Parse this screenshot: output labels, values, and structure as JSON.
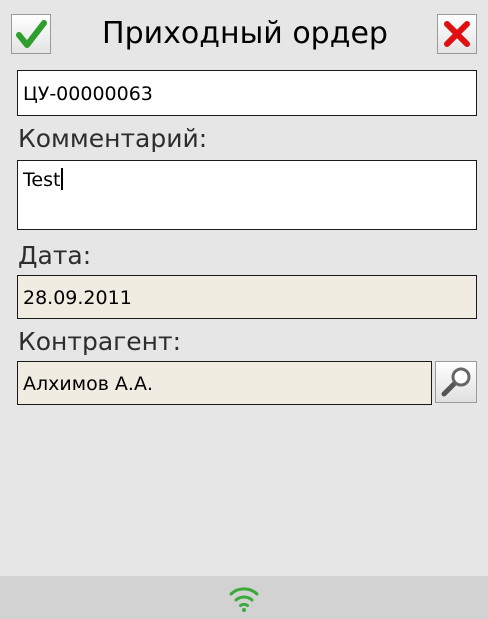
{
  "header": {
    "title": "Приходный ордер",
    "ok_icon": "checkmark-icon",
    "close_icon": "close-icon",
    "ok_color": "#2e9e2e",
    "close_color": "#e01010"
  },
  "form": {
    "document_number": "ЦУ-00000063",
    "comment_label": "Комментарий:",
    "comment_value": "Test",
    "date_label": "Дата:",
    "date_value": "28.09.2011",
    "counterparty_label": "Контрагент:",
    "counterparty_value": "Алхимов А.А.",
    "lookup_icon": "magnifier-icon"
  },
  "statusbar": {
    "icon": "wifi-icon",
    "icon_color": "#3aaa3a"
  },
  "colors": {
    "background": "#e6e6e6",
    "readonly_field": "#f0ece2",
    "statusbar": "#d2d2d2"
  }
}
